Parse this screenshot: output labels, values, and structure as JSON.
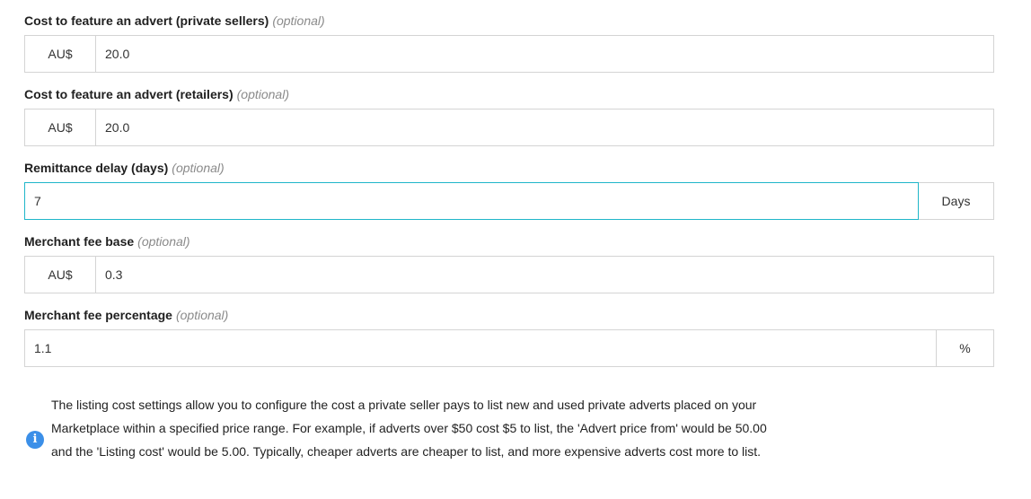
{
  "fields": [
    {
      "label": "Cost to feature an advert (private sellers)",
      "optional": "(optional)",
      "prefix": "AU$",
      "value": "20.0"
    },
    {
      "label": "Cost to feature an advert (retailers)",
      "optional": "(optional)",
      "prefix": "AU$",
      "value": "20.0"
    },
    {
      "label": "Remittance delay (days)",
      "optional": "(optional)",
      "value": "7",
      "suffix": "Days"
    },
    {
      "label": "Merchant fee base",
      "optional": "(optional)",
      "prefix": "AU$",
      "value": "0.3"
    },
    {
      "label": "Merchant fee percentage",
      "optional": "(optional)",
      "value": "1.1",
      "suffix": "%"
    }
  ],
  "info": {
    "icon": "info-icon",
    "text": "The listing cost settings allow you to configure the cost a private seller pays to list new and used private adverts placed on your Marketplace within a specified price range. For example, if adverts over $50 cost $5 to list, the 'Advert price from' would be 50.00 and the 'Listing cost' would be 5.00. Typically, cheaper adverts are cheaper to list, and more expensive adverts cost more to list."
  },
  "colors": {
    "focus_border": "#1fb6c9",
    "info_icon": "#3b8fe8",
    "optional_text": "#8a8a8a"
  }
}
